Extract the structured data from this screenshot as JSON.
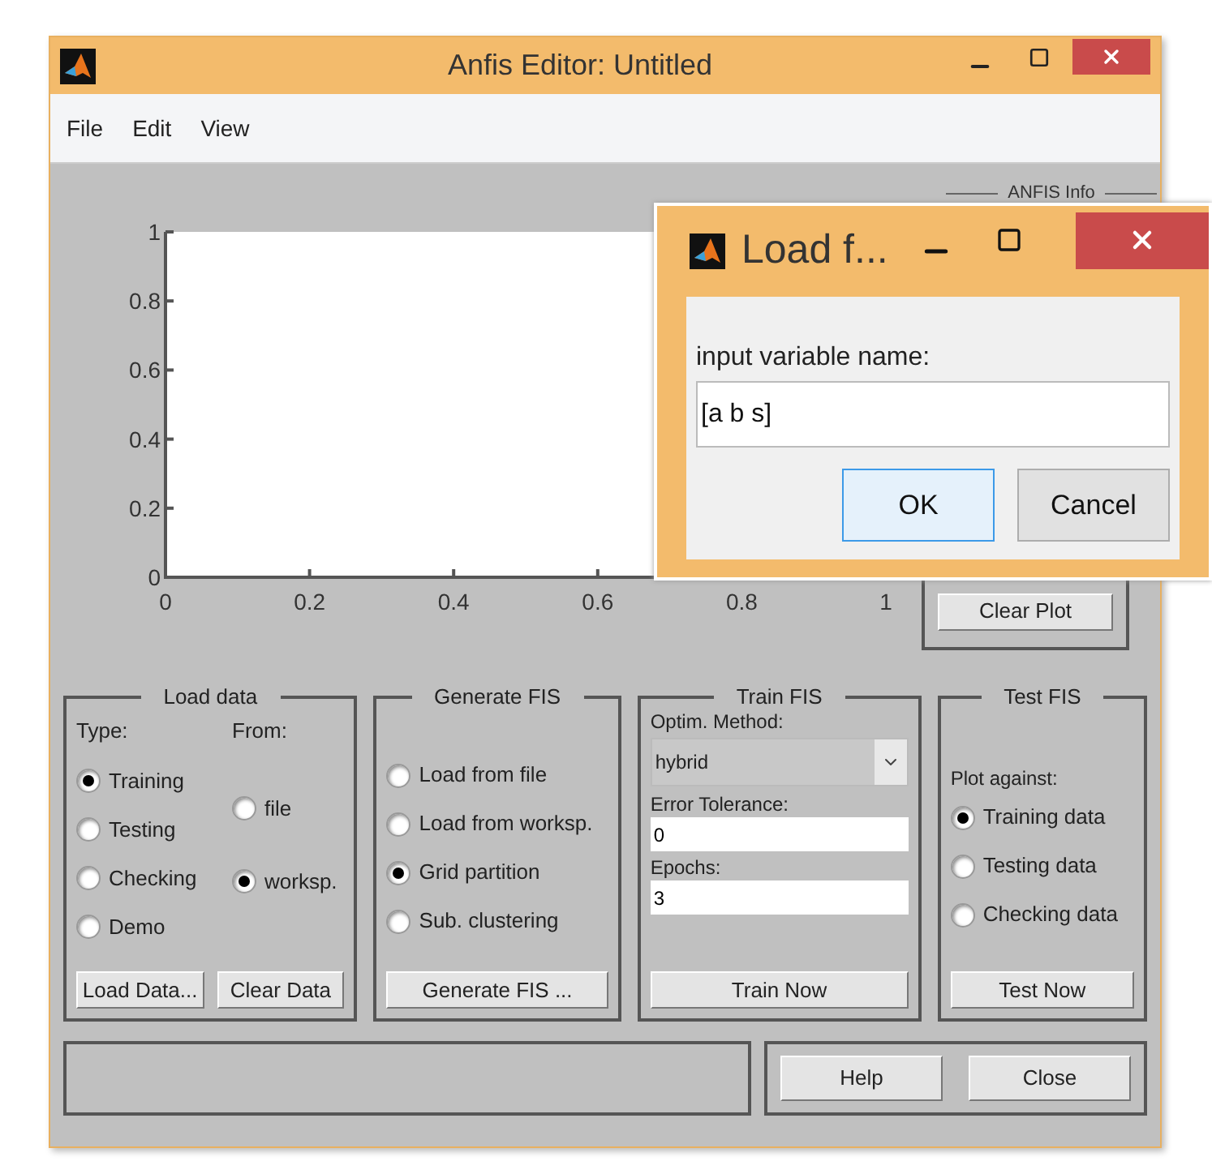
{
  "window": {
    "title": "Anfis Editor: Untitled"
  },
  "menu": [
    "File",
    "Edit",
    "View"
  ],
  "plot": {
    "chart_data": {
      "type": "line",
      "xlim": [
        0,
        1
      ],
      "ylim": [
        0,
        1
      ],
      "xticks": [
        0,
        0.2,
        0.4,
        0.6,
        0.8,
        1
      ],
      "yticks": [
        0,
        0.2,
        0.4,
        0.6,
        0.8,
        1
      ]
    }
  },
  "anfis_info": {
    "title": "ANFIS Info"
  },
  "clear_plot_button": "Clear Plot",
  "load_data": {
    "title": "Load data",
    "type_label": "Type:",
    "from_label": "From:",
    "types": [
      {
        "label": "Training",
        "selected": true
      },
      {
        "label": "Testing",
        "selected": false
      },
      {
        "label": "Checking",
        "selected": false
      },
      {
        "label": "Demo",
        "selected": false
      }
    ],
    "sources": [
      {
        "label": "file",
        "selected": false
      },
      {
        "label": "worksp.",
        "selected": true
      }
    ],
    "buttons": [
      "Load Data...",
      "Clear Data"
    ]
  },
  "generate_fis": {
    "title": "Generate FIS",
    "options": [
      {
        "label": "Load from file",
        "selected": false
      },
      {
        "label": "Load from worksp.",
        "selected": false
      },
      {
        "label": "Grid partition",
        "selected": true
      },
      {
        "label": "Sub. clustering",
        "selected": false
      }
    ],
    "button": "Generate FIS ..."
  },
  "train_fis": {
    "title": "Train FIS",
    "method_label": "Optim. Method:",
    "method": "hybrid",
    "tolerance_label": "Error Tolerance:",
    "tolerance": "0",
    "epochs_label": "Epochs:",
    "epochs": "3",
    "button": "Train Now"
  },
  "test_fis": {
    "title": "Test FIS",
    "plot_label": "Plot against:",
    "options": [
      {
        "label": "Training data",
        "selected": true
      },
      {
        "label": "Testing data",
        "selected": false
      },
      {
        "label": "Checking data",
        "selected": false
      }
    ],
    "button": "Test Now"
  },
  "footer_buttons": [
    "Help",
    "Close"
  ],
  "dialog": {
    "title": "Load f...",
    "label": "input variable name:",
    "value": "[a b s]",
    "buttons": [
      {
        "label": "OK",
        "default": true
      },
      {
        "label": "Cancel",
        "default": false
      }
    ]
  }
}
